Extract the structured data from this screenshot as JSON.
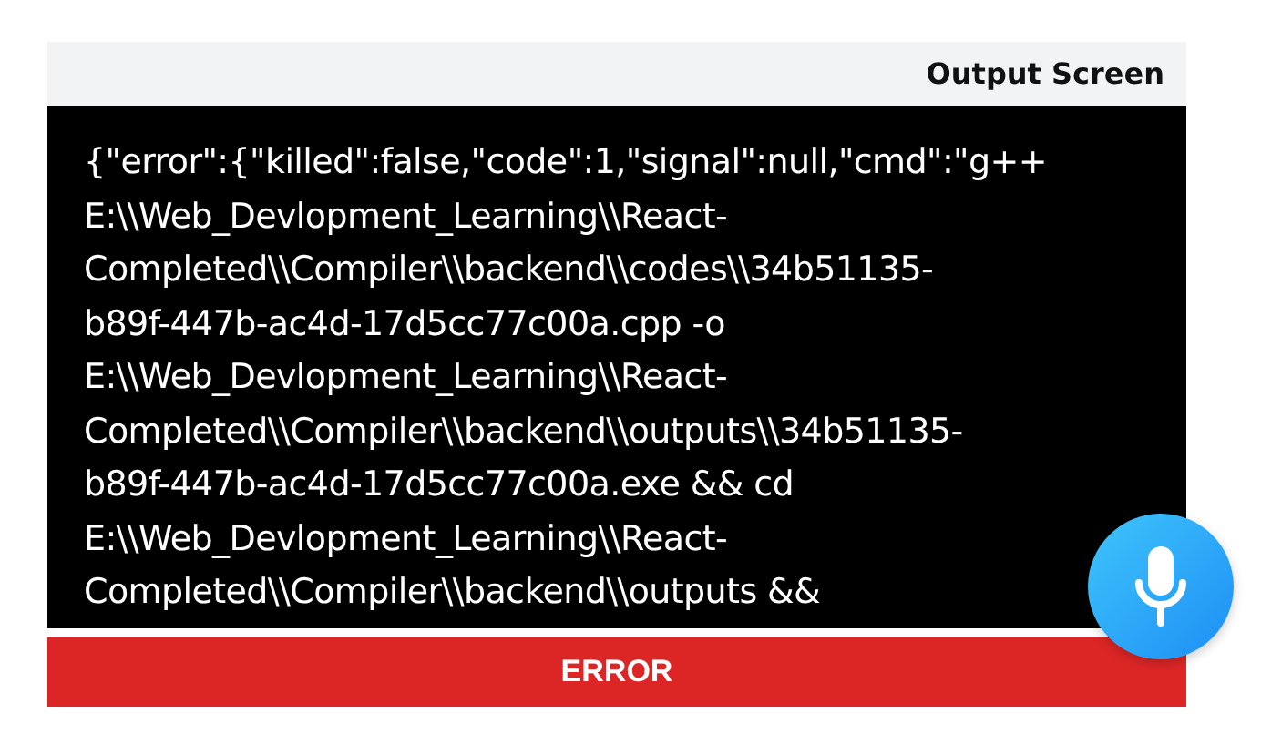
{
  "panel": {
    "title": "Output Screen",
    "output_lines": [
      "{\"error\":{\"killed\":false,\"code\":1,\"signal\":null,\"cmd\":\"g++",
      "E:\\\\Web_Devlopment_Learning\\\\React-",
      "Completed\\\\Compiler\\\\backend\\\\codes\\\\34b51135-",
      "b89f-447b-ac4d-17d5cc77c00a.cpp -o",
      "E:\\\\Web_Devlopment_Learning\\\\React-",
      "Completed\\\\Compiler\\\\backend\\\\outputs\\\\34b51135-",
      "b89f-447b-ac4d-17d5cc77c00a.exe && cd",
      "E:\\\\Web_Devlopment_Learning\\\\React-",
      "Completed\\\\Compiler\\\\backend\\\\outputs &&"
    ],
    "status": "ERROR"
  }
}
